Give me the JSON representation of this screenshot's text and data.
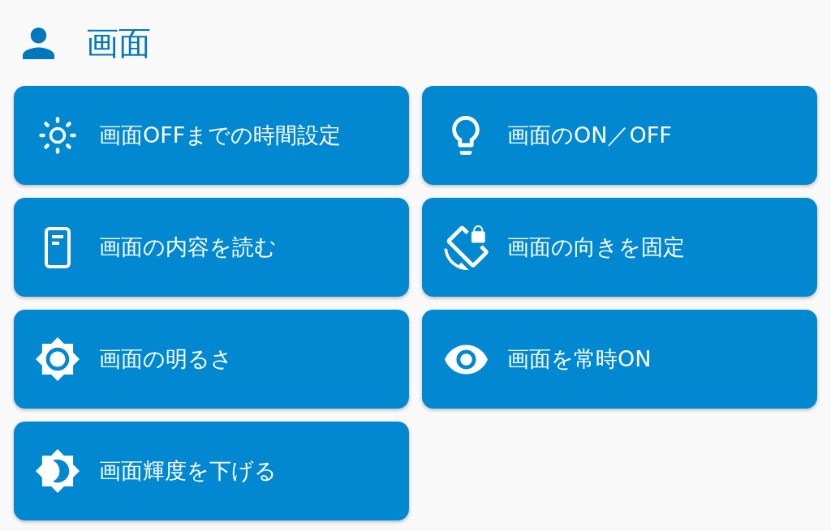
{
  "header": {
    "title": "画面"
  },
  "buttons": [
    {
      "label": "画面OFFまでの時間設定"
    },
    {
      "label": "画面のON／OFF"
    },
    {
      "label": "画面の内容を読む"
    },
    {
      "label": "画面の向きを固定"
    },
    {
      "label": "画面の明るさ"
    },
    {
      "label": "画面を常時ON"
    },
    {
      "label": "画面輝度を下げる"
    }
  ]
}
